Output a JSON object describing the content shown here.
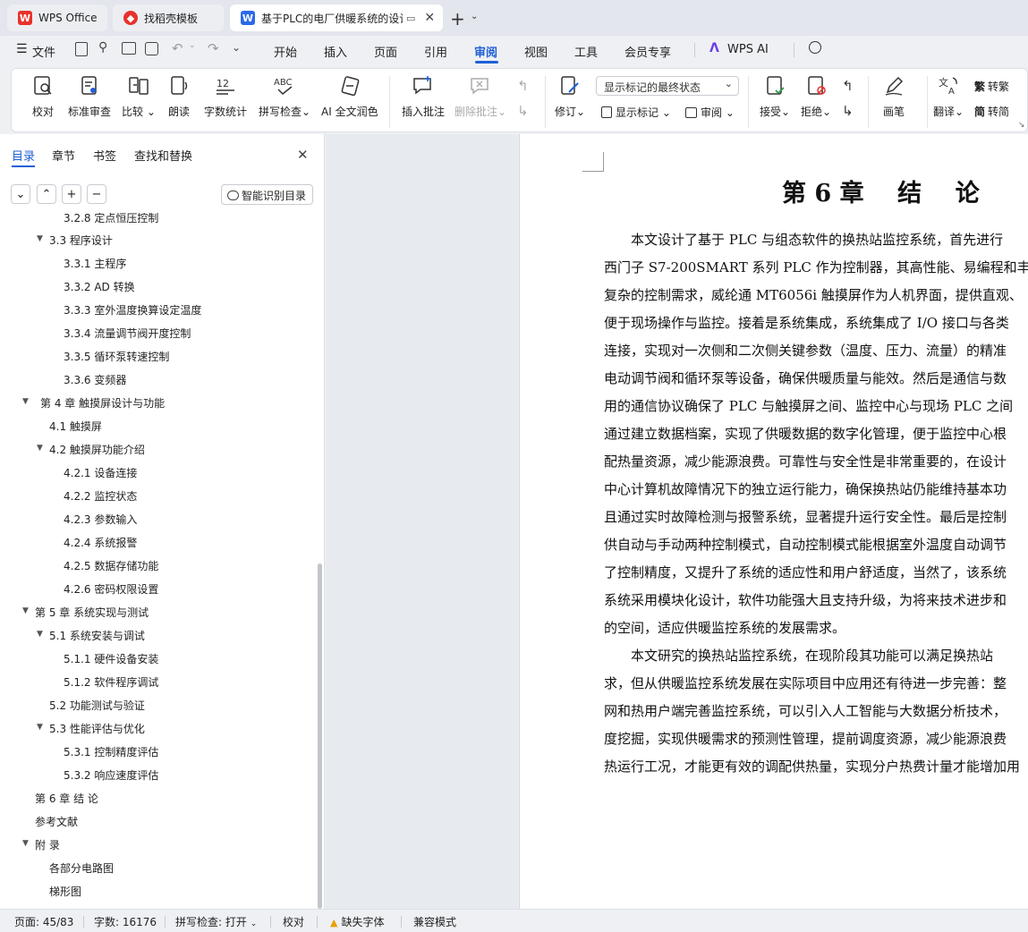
{
  "tabs": {
    "home": "WPS Office",
    "templates": "找稻壳模板",
    "document": "基于PLC的电厂供暖系统的设计"
  },
  "menubar": {
    "file": "文件",
    "items": [
      "开始",
      "插入",
      "页面",
      "引用",
      "审阅",
      "视图",
      "工具",
      "会员专享"
    ],
    "active": "审阅",
    "ai": "WPS AI"
  },
  "ribbon": {
    "proofread": "校对",
    "standard_review": "标准审查",
    "compare": "比较",
    "read_aloud": "朗读",
    "word_count": "字数统计",
    "spell_check": "拼写检查",
    "ai_polish": "AI 全文润色",
    "insert_comment": "插入批注",
    "delete_comment": "删除批注",
    "track_changes": "修订",
    "show_markup_select": "显示标记的最终状态",
    "show_markup": "显示标记",
    "review": "审阅",
    "accept": "接受",
    "reject": "拒绝",
    "brush": "画笔",
    "translate": "翻译",
    "to_traditional": "转繁",
    "to_simplified": "转简"
  },
  "nav": {
    "tabs": [
      "目录",
      "章节",
      "书签",
      "查找和替换"
    ],
    "smart_toc": "智能识别目录",
    "cut_item": "3.2.8  定点恒压控制",
    "items": [
      {
        "text": "3.3  程序设计",
        "level": 2,
        "arrow": true
      },
      {
        "text": "3.3.1  主程序",
        "level": 3
      },
      {
        "text": "3.3.2 AD 转换",
        "level": 3
      },
      {
        "text": "3.3.3  室外温度换算设定温度",
        "level": 3
      },
      {
        "text": "3.3.4  流量调节阀开度控制",
        "level": 3
      },
      {
        "text": "3.3.5  循环泵转速控制",
        "level": 3
      },
      {
        "text": "3.3.6  变频器",
        "level": 3
      },
      {
        "text": "第 4 章    触摸屏设计与功能",
        "level": 1,
        "arrow": true,
        "indent": 45
      },
      {
        "text": "4.1  触摸屏",
        "level": 2
      },
      {
        "text": "4.2  触摸屏功能介绍",
        "level": 2,
        "arrow": true
      },
      {
        "text": "4.2.1  设备连接",
        "level": 3
      },
      {
        "text": "4.2.2  监控状态",
        "level": 3
      },
      {
        "text": "4.2.3  参数输入",
        "level": 3
      },
      {
        "text": "4.2.4  系统报警",
        "level": 3
      },
      {
        "text": "4.2.5  数据存储功能",
        "level": 3
      },
      {
        "text": "4.2.6  密码权限设置",
        "level": 3
      },
      {
        "text": "第 5 章    系统实现与测试",
        "level": 1,
        "arrow": true
      },
      {
        "text": "5.1  系统安装与调试",
        "level": 2,
        "arrow": true
      },
      {
        "text": "5.1.1  硬件设备安装",
        "level": 3
      },
      {
        "text": "5.1.2  软件程序调试",
        "level": 3
      },
      {
        "text": "5.2  功能测试与验证",
        "level": 2
      },
      {
        "text": "5.3 性能评估与优化",
        "level": 2,
        "arrow": true
      },
      {
        "text": "5.3.1  控制精度评估",
        "level": 3
      },
      {
        "text": "5.3.2  响应速度评估",
        "level": 3
      },
      {
        "text": "第 6 章    结    论",
        "level": 1
      },
      {
        "text": "参考文献",
        "level": 1
      },
      {
        "text": "附    录",
        "level": 1,
        "arrow": true
      },
      {
        "text": "各部分电路图",
        "level": 2
      },
      {
        "text": "梯形图",
        "level": 2
      }
    ]
  },
  "document": {
    "heading": "第 6 章    结    论",
    "lines": [
      "　　本文设计了基于 PLC 与组态软件的换热站监控系统，首先进行",
      "西门子 S7-200SMART 系列 PLC 作为控制器，其高性能、易编程和丰",
      "复杂的控制需求，威纶通 MT6056i 触摸屏作为人机界面，提供直观、",
      "便于现场操作与监控。接着是系统集成，系统集成了 I/O 接口与各类",
      "连接，实现对一次侧和二次侧关键参数（温度、压力、流量）的精准",
      "电动调节阀和循环泵等设备，确保供暖质量与能效。然后是通信与数",
      "用的通信协议确保了 PLC 与触摸屏之间、监控中心与现场 PLC 之间",
      "通过建立数据档案，实现了供暖数据的数字化管理，便于监控中心根",
      "配热量资源，减少能源浪费。可靠性与安全性是非常重要的，在设计",
      "中心计算机故障情况下的独立运行能力，确保换热站仍能维持基本功",
      "且通过实时故障检测与报警系统，显著提升运行安全性。最后是控制",
      "供自动与手动两种控制模式，自动控制模式能根据室外温度自动调节",
      "了控制精度，又提升了系统的适应性和用户舒适度，当然了，该系统",
      "系统采用模块化设计，软件功能强大且支持升级，为将来技术进步和",
      "的空间，适应供暖监控系统的发展需求。",
      "　　本文研究的换热站监控系统，在现阶段其功能可以满足换热站",
      "求，但从供暖监控系统发展在实际项目中应用还有待进一步完善：整",
      "网和热用户端完善监控系统，可以引入人工智能与大数据分析技术，",
      "度挖掘，实现供暖需求的预测性管理，提前调度资源，减少能源浪费",
      "热运行工况，才能更有效的调配供热量，实现分户热费计量才能增加用"
    ]
  },
  "status": {
    "page": "页面: 45/83",
    "words": "字数: 16176",
    "spell": "拼写检查: 打开",
    "proof": "校对",
    "missing_font": "缺失字体",
    "compat": "兼容模式"
  },
  "colors": {
    "accent": "#1f5fd6",
    "wps_red": "#e8322c"
  }
}
